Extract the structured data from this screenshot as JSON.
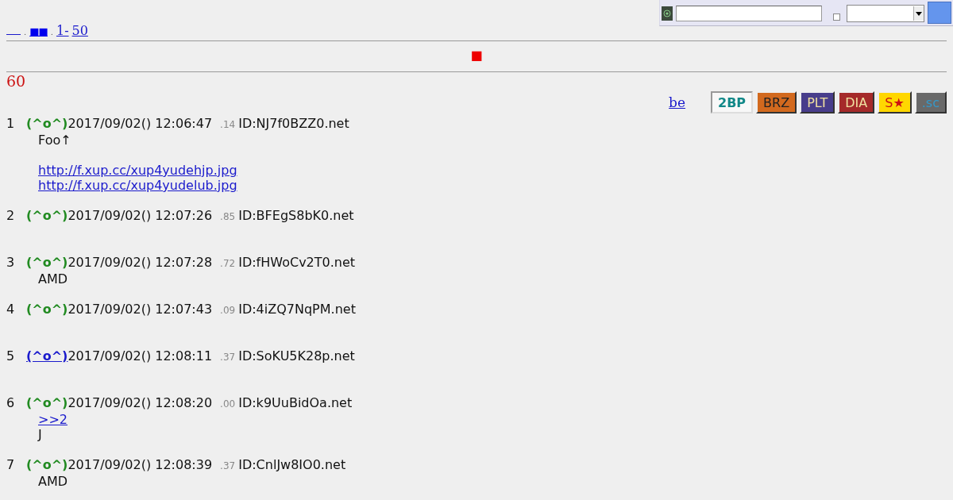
{
  "search_form": {
    "checkbox_checked": false
  },
  "nav": [
    {
      "kind": "blank-link"
    },
    {
      "kind": "dot",
      "text": "."
    },
    {
      "kind": "link",
      "text": "■■"
    },
    {
      "kind": "dot",
      "text": "."
    },
    {
      "kind": "link",
      "text": "1-"
    },
    {
      "kind": "link",
      "text": "50"
    }
  ],
  "banner_mark": "■",
  "thread_count": "60",
  "be_link": "be",
  "view_buttons": [
    {
      "label": "2BP",
      "selected": true,
      "color": "#f8f8f8"
    },
    {
      "label": "BRZ",
      "selected": false,
      "color": "#d2691e"
    },
    {
      "label": "PLT",
      "selected": false,
      "color": "#483d8b"
    },
    {
      "label": "DIA",
      "selected": false,
      "color": "#a52a2a"
    },
    {
      "label": "S★",
      "selected": false,
      "color": "#ffd700"
    },
    {
      "label": ".sc",
      "selected": false,
      "color": "#696969"
    }
  ],
  "posts": [
    {
      "number": "1",
      "name": "(^o^)",
      "name_linked": false,
      "date": "2017/09/02() 12:06:47",
      "fraction": ".14",
      "id": "ID:NJ7f0BZZ0.net",
      "body": [
        {
          "kind": "text",
          "text": "Foo↑"
        },
        {
          "kind": "blank"
        },
        {
          "kind": "link",
          "text": "http://f.xup.cc/xup4yudehjp.jpg"
        },
        {
          "kind": "link",
          "text": "http://f.xup.cc/xup4yudelub.jpg"
        }
      ]
    },
    {
      "number": "2",
      "name": "(^o^)",
      "name_linked": false,
      "date": "2017/09/02() 12:07:26",
      "fraction": ".85",
      "id": "ID:BFEgS8bK0.net"
    },
    {
      "number": "3",
      "name": "(^o^)",
      "name_linked": false,
      "date": "2017/09/02() 12:07:28",
      "fraction": ".72",
      "id": "ID:fHWoCv2T0.net",
      "body": [
        {
          "kind": "text",
          "text": "AMD"
        }
      ]
    },
    {
      "number": "4",
      "name": "(^o^)",
      "name_linked": false,
      "date": "2017/09/02() 12:07:43",
      "fraction": ".09",
      "id": "ID:4iZQ7NqPM.net"
    },
    {
      "number": "5",
      "name": "(^o^)",
      "name_linked": true,
      "date": "2017/09/02() 12:08:11",
      "fraction": ".37",
      "id": "ID:SoKU5K28p.net"
    },
    {
      "number": "6",
      "name": "(^o^)",
      "name_linked": false,
      "date": "2017/09/02() 12:08:20",
      "fraction": ".00",
      "id": "ID:k9UuBidOa.net",
      "body": [
        {
          "kind": "link",
          "text": ">>2"
        },
        {
          "kind": "text",
          "text": "J"
        }
      ]
    },
    {
      "number": "7",
      "name": "(^o^)",
      "name_linked": false,
      "date": "2017/09/02() 12:08:39",
      "fraction": ".37",
      "id": "ID:CnlJw8IO0.net",
      "body": [
        {
          "kind": "text",
          "text": "AMD"
        }
      ]
    }
  ]
}
